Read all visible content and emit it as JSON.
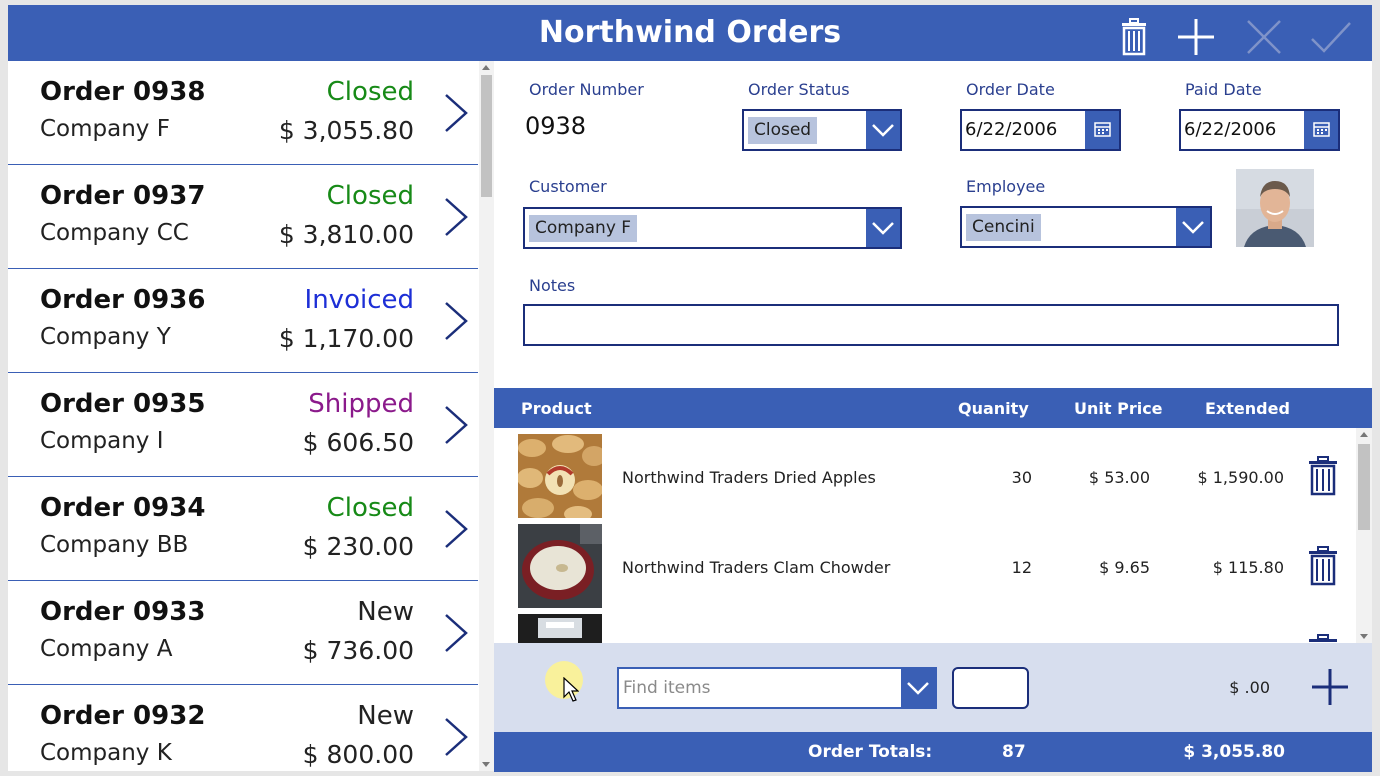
{
  "app": {
    "title": "Northwind Orders",
    "colors": {
      "header": "#3a5fb5",
      "accent_dark": "#1b2e7a",
      "status_closed": "#178a17",
      "status_invoiced": "#1d2fd6",
      "status_shipped": "#8b1a8b",
      "status_new": "#222222"
    }
  },
  "toolbar": {
    "icons": [
      "trash-icon",
      "plus-icon",
      "close-icon",
      "check-icon"
    ]
  },
  "orders": [
    {
      "title": "Order 0938",
      "company": "Company F",
      "status": "Closed",
      "total": "$ 3,055.80"
    },
    {
      "title": "Order 0937",
      "company": "Company CC",
      "status": "Closed",
      "total": "$ 3,810.00"
    },
    {
      "title": "Order 0936",
      "company": "Company Y",
      "status": "Invoiced",
      "total": "$ 1,170.00"
    },
    {
      "title": "Order 0935",
      "company": "Company I",
      "status": "Shipped",
      "total": "$ 606.50"
    },
    {
      "title": "Order 0934",
      "company": "Company BB",
      "status": "Closed",
      "total": "$ 230.00"
    },
    {
      "title": "Order 0933",
      "company": "Company A",
      "status": "New",
      "total": "$ 736.00"
    },
    {
      "title": "Order 0932",
      "company": "Company K",
      "status": "New",
      "total": "$ 800.00"
    }
  ],
  "form": {
    "order_number_label": "Order Number",
    "order_number": "0938",
    "order_status_label": "Order Status",
    "order_status": "Closed",
    "order_date_label": "Order Date",
    "order_date": "6/22/2006",
    "paid_date_label": "Paid Date",
    "paid_date": "6/22/2006",
    "customer_label": "Customer",
    "customer": "Company F",
    "employee_label": "Employee",
    "employee": "Cencini",
    "notes_label": "Notes",
    "notes": ""
  },
  "grid": {
    "headers": {
      "product": "Product",
      "quantity": "Quanity",
      "unit_price": "Unit Price",
      "extended": "Extended"
    },
    "rows": [
      {
        "product": "Northwind Traders Dried Apples",
        "quantity": "30",
        "unit_price": "$ 53.00",
        "extended": "$ 1,590.00"
      },
      {
        "product": "Northwind Traders Clam Chowder",
        "quantity": "12",
        "unit_price": "$ 9.65",
        "extended": "$ 115.80"
      }
    ]
  },
  "add_item": {
    "find_placeholder": "Find items",
    "quantity": "",
    "extended": "$ .00"
  },
  "totals": {
    "label": "Order Totals:",
    "quantity": "87",
    "amount": "$ 3,055.80"
  }
}
